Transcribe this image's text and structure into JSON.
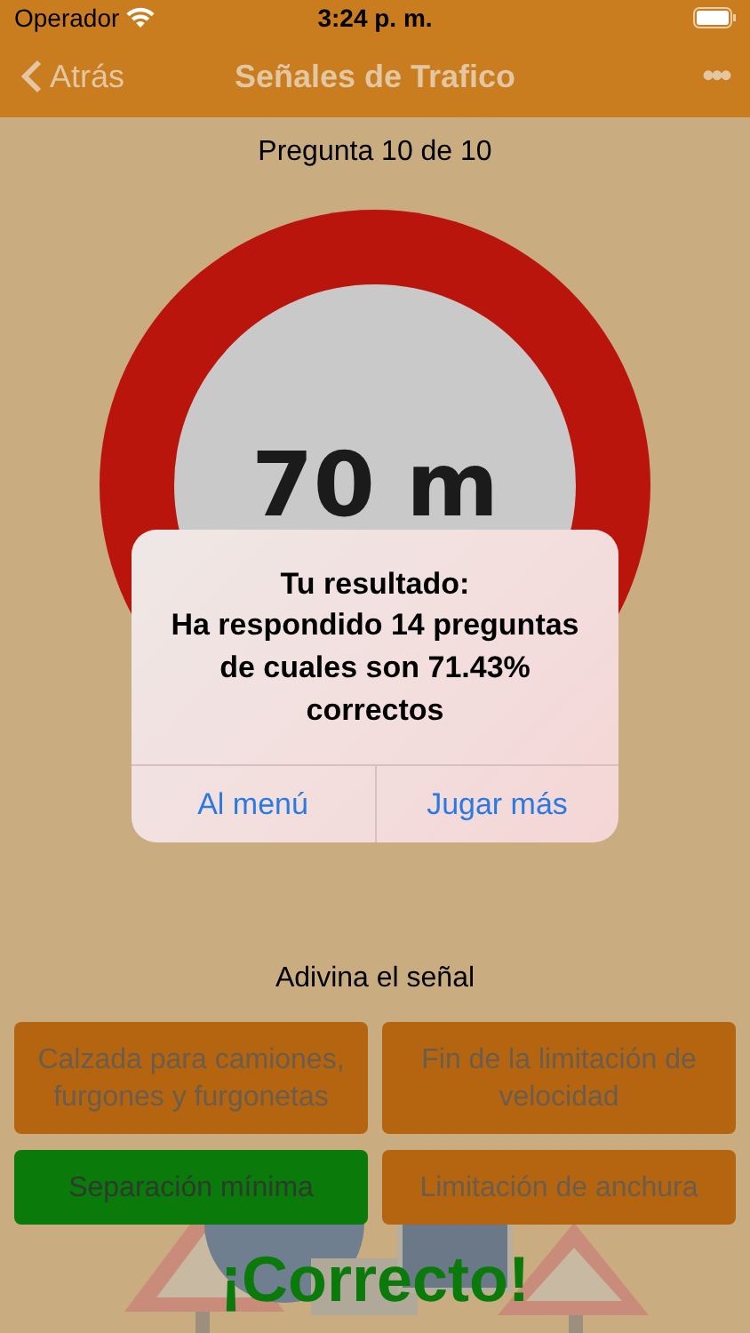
{
  "status_bar": {
    "carrier": "Operador",
    "time": "3:24 p. m."
  },
  "nav": {
    "back": "Atrás",
    "title": "Señales de Trafico",
    "more": "•••"
  },
  "progress": "Pregunta 10 de 10",
  "sign": {
    "text": "70 m"
  },
  "alert": {
    "title": "Tu resultado:",
    "message": "Ha respondido 14 preguntas de cuales son 71.43% correctos",
    "buttons": [
      "Al menú",
      "Jugar más"
    ]
  },
  "prompt": "Adivina el señal",
  "answers": [
    {
      "label": "Calzada para camiones, furgones y furgonetas",
      "selected": false
    },
    {
      "label": "Fin de la limitación de velocidad",
      "selected": false
    },
    {
      "label": "Separación mínima",
      "selected": true
    },
    {
      "label": "Limitación de anchura",
      "selected": false
    }
  ],
  "feedback": "¡Correcto!"
}
